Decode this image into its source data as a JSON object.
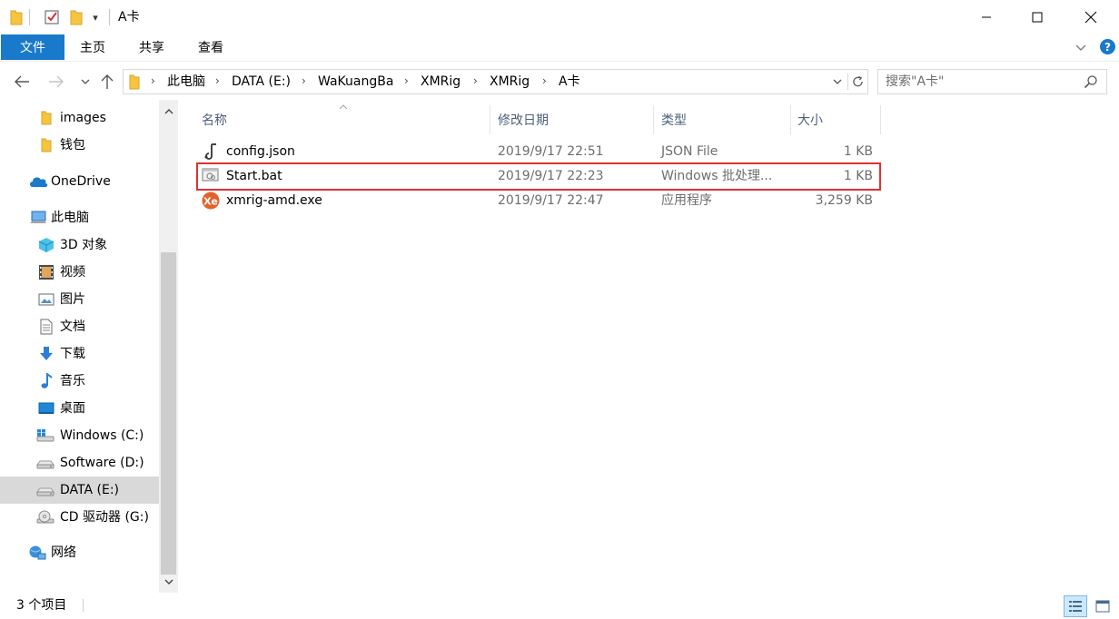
{
  "window": {
    "title": "A卡",
    "quick_access_dropdown": "▾",
    "controls": {
      "minimize": "minimize",
      "maximize": "maximize",
      "close": "close"
    }
  },
  "ribbon": {
    "tabs": [
      {
        "label": "文件",
        "active": true
      },
      {
        "label": "主页"
      },
      {
        "label": "共享"
      },
      {
        "label": "查看"
      }
    ],
    "help_label": "?"
  },
  "address_bar": {
    "breadcrumbs": [
      "此电脑",
      "DATA (E:)",
      "WaKuangBa",
      "XMRig",
      "XMRig",
      "A卡"
    ],
    "separator": "›"
  },
  "search": {
    "placeholder": "搜索\"A卡\""
  },
  "navigation": {
    "items": [
      {
        "label": "images",
        "icon": "folder-icon"
      },
      {
        "label": "钱包",
        "icon": "folder-icon"
      },
      {
        "label": "OneDrive",
        "icon": "onedrive-cloud-icon"
      },
      {
        "label": "此电脑",
        "icon": "this-pc-icon"
      },
      {
        "label": "3D 对象",
        "icon": "3d-objects-icon"
      },
      {
        "label": "视频",
        "icon": "videos-icon"
      },
      {
        "label": "图片",
        "icon": "pictures-icon"
      },
      {
        "label": "文档",
        "icon": "documents-icon"
      },
      {
        "label": "下载",
        "icon": "downloads-icon"
      },
      {
        "label": "音乐",
        "icon": "music-icon"
      },
      {
        "label": "桌面",
        "icon": "desktop-icon"
      },
      {
        "label": "Windows (C:)",
        "icon": "windows-drive-icon"
      },
      {
        "label": "Software (D:)",
        "icon": "drive-icon"
      },
      {
        "label": "DATA (E:)",
        "icon": "drive-icon",
        "selected": true
      },
      {
        "label": "CD 驱动器 (G:)",
        "icon": "cd-drive-icon"
      },
      {
        "label": "网络",
        "icon": "network-icon"
      }
    ]
  },
  "file_list": {
    "columns": [
      "名称",
      "修改日期",
      "类型",
      "大小"
    ],
    "rows": [
      {
        "name": "config.json",
        "modified": "2019/9/17 22:51",
        "type": "JSON File",
        "size": "1 KB",
        "icon": "json-file-icon"
      },
      {
        "name": "Start.bat",
        "modified": "2019/9/17 22:23",
        "type": "Windows 批处理...",
        "size": "1 KB",
        "icon": "batch-file-icon",
        "highlighted": true
      },
      {
        "name": "xmrig-amd.exe",
        "modified": "2019/9/17 22:47",
        "type": "应用程序",
        "size": "3,259 KB",
        "icon": "xmrig-app-icon"
      }
    ]
  },
  "status_bar": {
    "item_count": "3 个项目"
  },
  "colors": {
    "accent": "#1979ca",
    "selected_nav": "#d9d9d9",
    "highlight_box": "#e03030",
    "header_text": "#4c607a",
    "meta_text": "#6d6d6d"
  }
}
